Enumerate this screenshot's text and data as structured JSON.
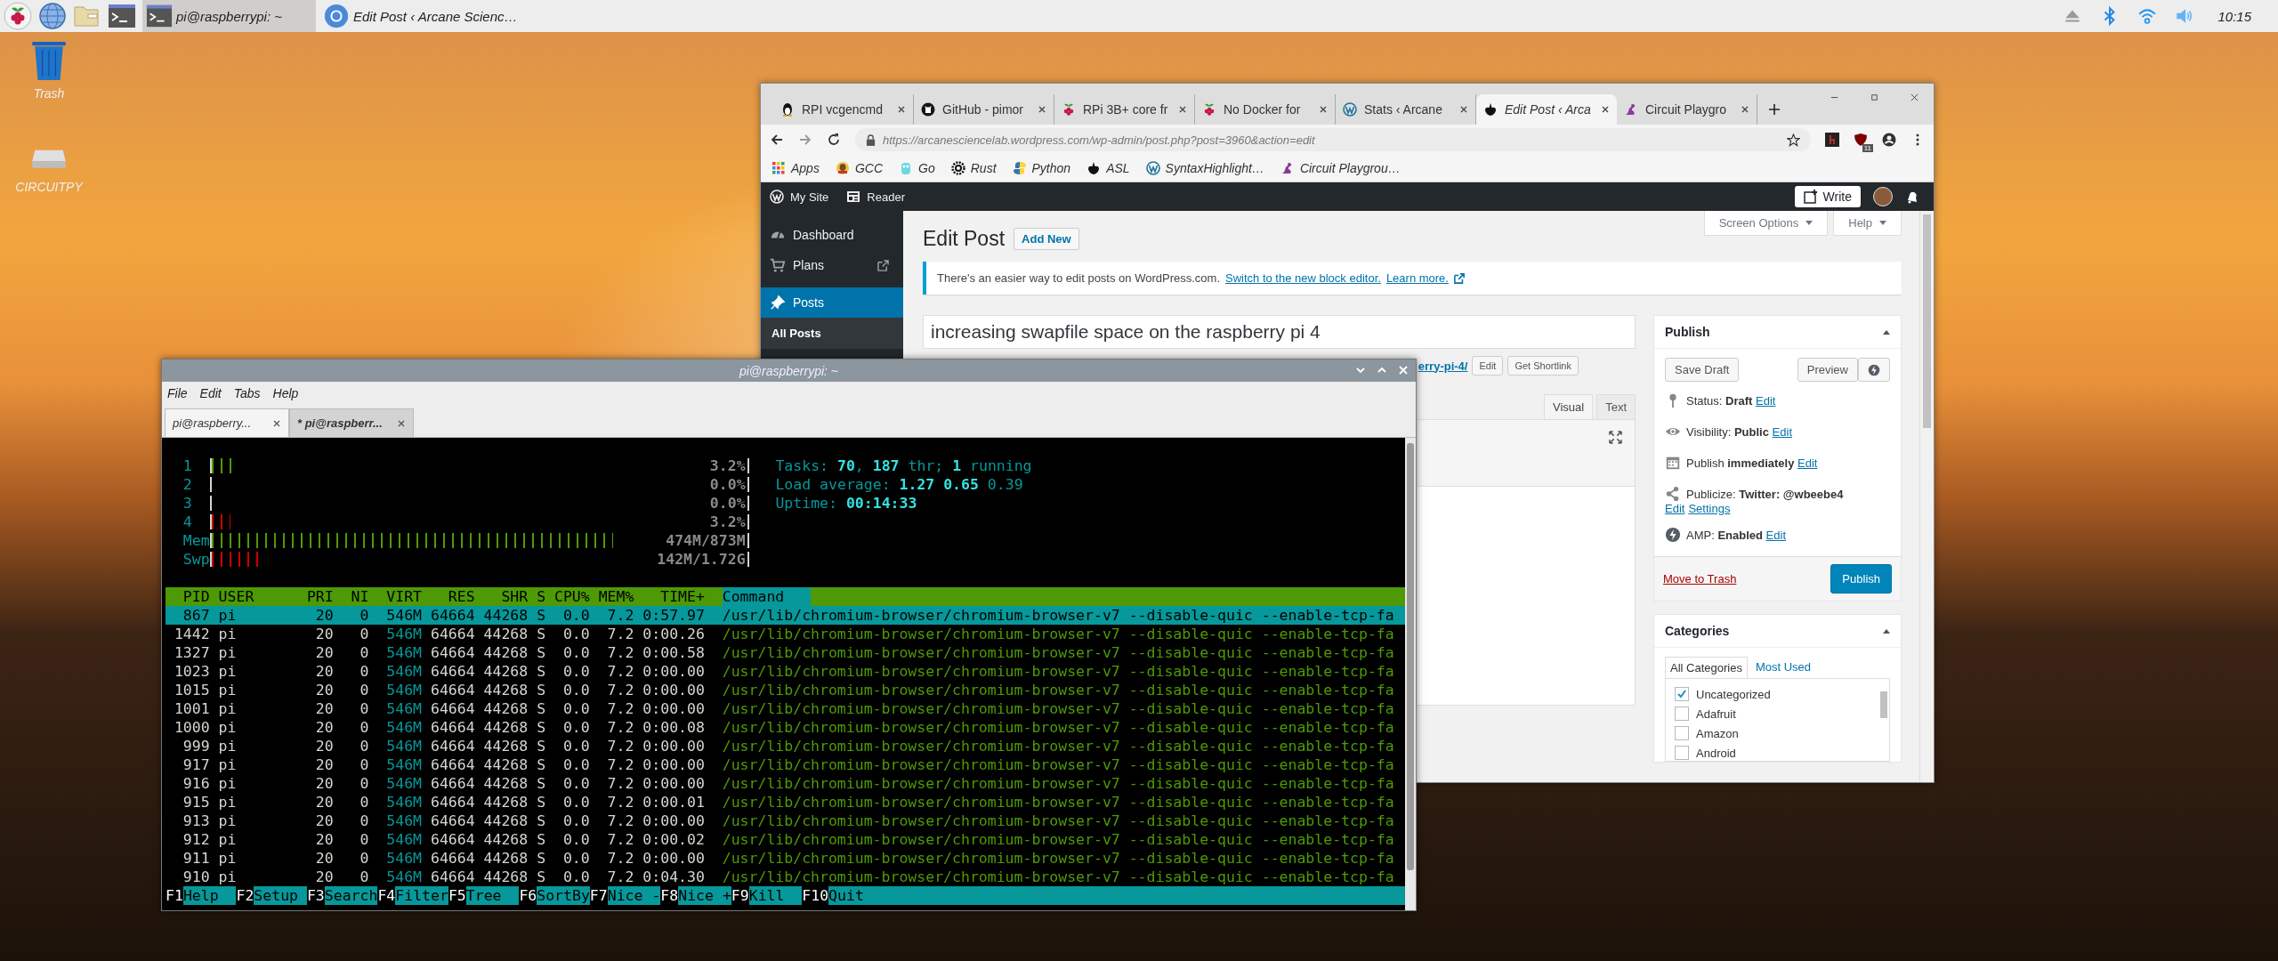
{
  "taskbar": {
    "tasks": [
      {
        "label": "pi@raspberrypi: ~",
        "selected": true
      },
      {
        "label": "Edit Post ‹ Arcane Scienc…",
        "selected": false
      }
    ],
    "clock": "10:15"
  },
  "desktop_icons": [
    {
      "label": "Trash"
    },
    {
      "label": "CIRCUITPY"
    }
  ],
  "browser": {
    "tabs": [
      {
        "label": "RPI vcgencmd",
        "selected": false
      },
      {
        "label": "GitHub - pimor",
        "selected": false
      },
      {
        "label": "RPi 3B+ core fr",
        "selected": false
      },
      {
        "label": "No Docker for",
        "selected": false
      },
      {
        "label": "Stats ‹ Arcane",
        "selected": false
      },
      {
        "label": "Edit Post ‹ Arca",
        "selected": true
      },
      {
        "label": "Circuit Playgro",
        "selected": false
      }
    ],
    "url": "https://arcanesciencelab.wordpress.com/wp-admin/post.php?post=3960&action=edit",
    "bookmarks": [
      "Apps",
      "GCC",
      "Go",
      "Rust",
      "Python",
      "ASL",
      "SyntaxHighlight…",
      "Circuit Playgrou…"
    ],
    "extension_badge": "11",
    "admin_bar": {
      "my_site": "My Site",
      "reader": "Reader",
      "write": "Write"
    },
    "menu": [
      {
        "label": "Dashboard",
        "selected": false
      },
      {
        "label": "Plans",
        "selected": false
      },
      {
        "label": "Posts",
        "selected": true
      }
    ],
    "submenu": [
      {
        "label": "All Posts",
        "selected": true
      }
    ],
    "heading": "Edit Post",
    "add_new": "Add New",
    "screen_options": "Screen Options",
    "help": "Help",
    "notice": {
      "text": "There's an easier way to edit posts on WordPress.com.",
      "links": [
        "Switch to the new block editor.",
        "Learn more."
      ]
    },
    "title_value": "increasing swapfile space on the raspberry pi 4",
    "permalink": {
      "link": "erry-pi-4/",
      "buttons": [
        "Edit",
        "Get Shortlink"
      ]
    },
    "editor_tabs": [
      {
        "label": "Visual",
        "selected": true
      },
      {
        "label": "Text",
        "selected": false
      }
    ],
    "publish": {
      "title": "Publish",
      "save_draft": "Save Draft",
      "preview": "Preview",
      "fields": [
        {
          "label": "Status:",
          "value": "Draft",
          "links": [
            "Edit"
          ]
        },
        {
          "label": "Visibility:",
          "value": "Public",
          "links": [
            "Edit"
          ]
        },
        {
          "label": "Publish",
          "value": "immediately",
          "links": [
            "Edit"
          ]
        },
        {
          "label": "Publicize:",
          "value": "Twitter: @wbeebe4",
          "links": [
            "Edit",
            "Settings"
          ]
        },
        {
          "label": "AMP:",
          "value": "Enabled",
          "links": [
            "Edit"
          ]
        }
      ],
      "trash": "Move to Trash",
      "publish": "Publish"
    },
    "categories": {
      "title": "Categories",
      "tabs": [
        {
          "label": "All Categories",
          "selected": true
        },
        {
          "label": "Most Used",
          "selected": false
        }
      ],
      "items": [
        {
          "label": "Uncategorized",
          "checked": true
        },
        {
          "label": "Adafruit",
          "checked": false
        },
        {
          "label": "Amazon",
          "checked": false
        },
        {
          "label": "Android",
          "checked": false
        }
      ]
    }
  },
  "terminal": {
    "title": "pi@raspberrypi: ~",
    "menu": [
      "File",
      "Edit",
      "Tabs",
      "Help"
    ],
    "tabs": [
      {
        "label": "pi@raspberry...",
        "selected": false
      },
      {
        "label": "* pi@raspberr...",
        "selected": true
      }
    ],
    "meters": [
      {
        "label": "1",
        "level": 0.05,
        "reading": "3.2%",
        "color": "#4e9a06"
      },
      {
        "label": "2",
        "reading": "0.0%"
      },
      {
        "label": "3",
        "reading": "0.0%"
      },
      {
        "label": "4",
        "level": 0.035,
        "reading": "3.2%",
        "color": "#cc0000"
      },
      {
        "label": "Mem",
        "level": 0.75,
        "reading": "474M/873M",
        "color": "#4e9a06"
      },
      {
        "label": "Swp",
        "level": 0.1,
        "reading": "142M/1.72G",
        "color": "#cc0000"
      }
    ],
    "summary": [
      "Tasks: **70**, **187** thr; **1** running",
      "Load average: **1.27** **0.65** 0.39",
      "Uptime: **00:14:33**"
    ],
    "columns": [
      "PID",
      "USER",
      "PRI",
      "NI",
      "VIRT",
      "RES",
      "SHR",
      "S",
      "CPU%",
      "MEM%",
      "TIME+",
      "Command"
    ],
    "processes": [
      {
        "pid": "867",
        "user": "pi",
        "pri": "20",
        "ni": "0",
        "virt": "546M",
        "res": "64664",
        "shr": "44268",
        "state": "S",
        "cpu": "0.0",
        "mem": "7.2",
        "time": "0:57.97",
        "command": "/usr/lib/chromium-browser/chromium-browser-v7 --disable-quic --enable-tcp-fa",
        "selected": true
      },
      {
        "pid": "1442",
        "user": "pi",
        "pri": "20",
        "ni": "0",
        "virt": "546M",
        "res": "64664",
        "shr": "44268",
        "state": "S",
        "cpu": "0.0",
        "mem": "7.2",
        "time": "0:00.26",
        "command": "/usr/lib/chromium-browser/chromium-browser-v7 --disable-quic --enable-tcp-fa",
        "selected": false
      },
      {
        "pid": "1327",
        "user": "pi",
        "pri": "20",
        "ni": "0",
        "virt": "546M",
        "res": "64664",
        "shr": "44268",
        "state": "S",
        "cpu": "0.0",
        "mem": "7.2",
        "time": "0:00.58",
        "command": "/usr/lib/chromium-browser/chromium-browser-v7 --disable-quic --enable-tcp-fa",
        "selected": false
      },
      {
        "pid": "1023",
        "user": "pi",
        "pri": "20",
        "ni": "0",
        "virt": "546M",
        "res": "64664",
        "shr": "44268",
        "state": "S",
        "cpu": "0.0",
        "mem": "7.2",
        "time": "0:00.00",
        "command": "/usr/lib/chromium-browser/chromium-browser-v7 --disable-quic --enable-tcp-fa",
        "selected": false
      },
      {
        "pid": "1015",
        "user": "pi",
        "pri": "20",
        "ni": "0",
        "virt": "546M",
        "res": "64664",
        "shr": "44268",
        "state": "S",
        "cpu": "0.0",
        "mem": "7.2",
        "time": "0:00.00",
        "command": "/usr/lib/chromium-browser/chromium-browser-v7 --disable-quic --enable-tcp-fa",
        "selected": false
      },
      {
        "pid": "1001",
        "user": "pi",
        "pri": "20",
        "ni": "0",
        "virt": "546M",
        "res": "64664",
        "shr": "44268",
        "state": "S",
        "cpu": "0.0",
        "mem": "7.2",
        "time": "0:00.00",
        "command": "/usr/lib/chromium-browser/chromium-browser-v7 --disable-quic --enable-tcp-fa",
        "selected": false
      },
      {
        "pid": "1000",
        "user": "pi",
        "pri": "20",
        "ni": "0",
        "virt": "546M",
        "res": "64664",
        "shr": "44268",
        "state": "S",
        "cpu": "0.0",
        "mem": "7.2",
        "time": "0:00.08",
        "command": "/usr/lib/chromium-browser/chromium-browser-v7 --disable-quic --enable-tcp-fa",
        "selected": false
      },
      {
        "pid": "999",
        "user": "pi",
        "pri": "20",
        "ni": "0",
        "virt": "546M",
        "res": "64664",
        "shr": "44268",
        "state": "S",
        "cpu": "0.0",
        "mem": "7.2",
        "time": "0:00.00",
        "command": "/usr/lib/chromium-browser/chromium-browser-v7 --disable-quic --enable-tcp-fa",
        "selected": false
      },
      {
        "pid": "917",
        "user": "pi",
        "pri": "20",
        "ni": "0",
        "virt": "546M",
        "res": "64664",
        "shr": "44268",
        "state": "S",
        "cpu": "0.0",
        "mem": "7.2",
        "time": "0:00.00",
        "command": "/usr/lib/chromium-browser/chromium-browser-v7 --disable-quic --enable-tcp-fa",
        "selected": false
      },
      {
        "pid": "916",
        "user": "pi",
        "pri": "20",
        "ni": "0",
        "virt": "546M",
        "res": "64664",
        "shr": "44268",
        "state": "S",
        "cpu": "0.0",
        "mem": "7.2",
        "time": "0:00.00",
        "command": "/usr/lib/chromium-browser/chromium-browser-v7 --disable-quic --enable-tcp-fa",
        "selected": false
      },
      {
        "pid": "915",
        "user": "pi",
        "pri": "20",
        "ni": "0",
        "virt": "546M",
        "res": "64664",
        "shr": "44268",
        "state": "S",
        "cpu": "0.0",
        "mem": "7.2",
        "time": "0:00.01",
        "command": "/usr/lib/chromium-browser/chromium-browser-v7 --disable-quic --enable-tcp-fa",
        "selected": false
      },
      {
        "pid": "913",
        "user": "pi",
        "pri": "20",
        "ni": "0",
        "virt": "546M",
        "res": "64664",
        "shr": "44268",
        "state": "S",
        "cpu": "0.0",
        "mem": "7.2",
        "time": "0:00.00",
        "command": "/usr/lib/chromium-browser/chromium-browser-v7 --disable-quic --enable-tcp-fa",
        "selected": false
      },
      {
        "pid": "912",
        "user": "pi",
        "pri": "20",
        "ni": "0",
        "virt": "546M",
        "res": "64664",
        "shr": "44268",
        "state": "S",
        "cpu": "0.0",
        "mem": "7.2",
        "time": "0:00.02",
        "command": "/usr/lib/chromium-browser/chromium-browser-v7 --disable-quic --enable-tcp-fa",
        "selected": false
      },
      {
        "pid": "911",
        "user": "pi",
        "pri": "20",
        "ni": "0",
        "virt": "546M",
        "res": "64664",
        "shr": "44268",
        "state": "S",
        "cpu": "0.0",
        "mem": "7.2",
        "time": "0:00.00",
        "command": "/usr/lib/chromium-browser/chromium-browser-v7 --disable-quic --enable-tcp-fa",
        "selected": false
      },
      {
        "pid": "910",
        "user": "pi",
        "pri": "20",
        "ni": "0",
        "virt": "546M",
        "res": "64664",
        "shr": "44268",
        "state": "S",
        "cpu": "0.0",
        "mem": "7.2",
        "time": "0:04.30",
        "command": "/usr/lib/chromium-browser/chromium-browser-v7 --disable-quic --enable-tcp-fa",
        "selected": false
      }
    ],
    "function_keys": [
      {
        "key": "F1",
        "label": "Help"
      },
      {
        "key": "F2",
        "label": "Setup"
      },
      {
        "key": "F3",
        "label": "Search"
      },
      {
        "key": "F4",
        "label": "Filter"
      },
      {
        "key": "F5",
        "label": "Tree"
      },
      {
        "key": "F6",
        "label": "SortBy"
      },
      {
        "key": "F7",
        "label": "Nice -"
      },
      {
        "key": "F8",
        "label": "Nice +"
      },
      {
        "key": "F9",
        "label": "Kill"
      },
      {
        "key": "F10",
        "label": "Quit"
      }
    ]
  }
}
